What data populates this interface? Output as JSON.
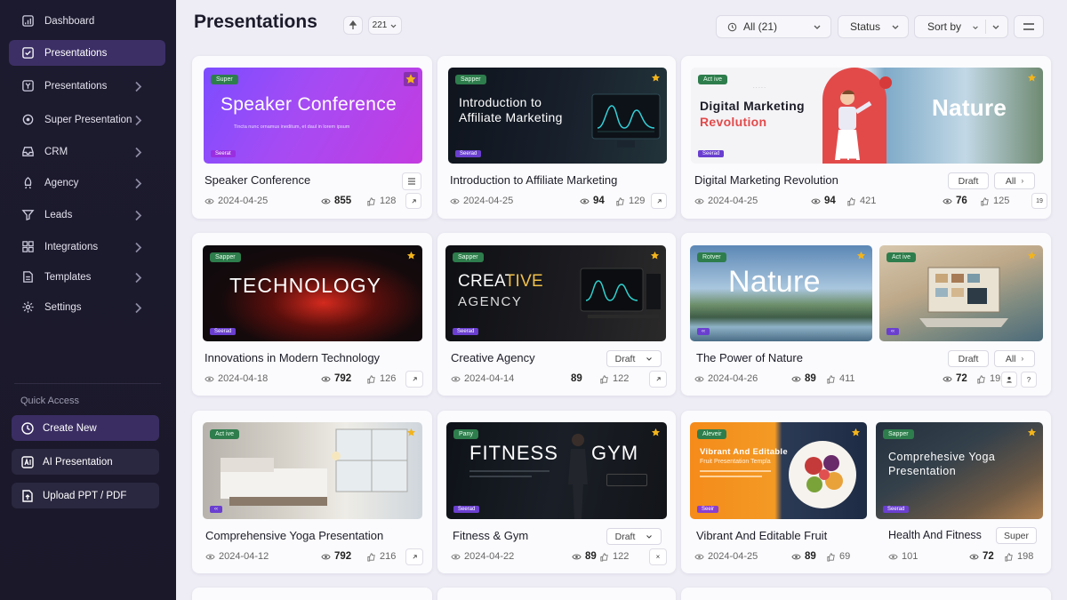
{
  "sidebar": {
    "items": [
      {
        "label": "Dashboard",
        "icon": "dashboard-icon"
      },
      {
        "label": "Presentations",
        "icon": "check-square-icon",
        "active": true
      },
      {
        "label": "Presentations",
        "icon": "y-square-icon"
      },
      {
        "label": "Super Presentation",
        "icon": "gear-badge-icon"
      },
      {
        "label": "CRM",
        "icon": "tray-icon"
      },
      {
        "label": "Agency",
        "icon": "rocket-icon"
      },
      {
        "label": "Leads",
        "icon": "funnel-icon"
      },
      {
        "label": "Integrations",
        "icon": "grid-icon"
      },
      {
        "label": "Templates",
        "icon": "document-icon"
      },
      {
        "label": "Settings",
        "icon": "settings-icon"
      }
    ],
    "quick_access": {
      "title": "Quick Access",
      "buttons": [
        {
          "label": "Create New",
          "icon": "clock-icon"
        },
        {
          "label": "AI Presentation",
          "icon": "ai-icon"
        },
        {
          "label": "Upload PPT / PDF",
          "icon": "upload-icon"
        }
      ]
    }
  },
  "header": {
    "title": "Presentations",
    "count_select": "221",
    "filter_all": "All (21)",
    "status": "Status",
    "sort": "Sort by"
  },
  "cards": [
    {
      "thumb_title": "Speaker Conference",
      "thumb_sub": "Tincta nunc ornamus ineditum, et daul in lorem ipsum",
      "badge": "Super",
      "tag": "Seerat",
      "title": "Speaker Conference",
      "date": "2024-04-25",
      "views": "855",
      "likes": "128"
    },
    {
      "thumb_title": "Introduction to Affiliate Marketing",
      "badge": "Sapper",
      "tag": "Seerad",
      "title": "Introduction to Affiliate Marketing",
      "date": "2024-04-25",
      "views": "94",
      "likes": "129"
    },
    {
      "thumb_title": "Digital Marketing",
      "thumb_title2": "Revolution",
      "thumb_title3": "Nature",
      "badge": "Act ive",
      "tag": "Seerad",
      "title": "Digital Marketing Revolution",
      "date": "2024-04-25",
      "views": "94",
      "likes": "421",
      "views2": "76",
      "likes2": "125",
      "chip1": "Draft",
      "chip2": "All",
      "count": "19"
    },
    {
      "thumb_title": "TECHNOLOGY",
      "badge": "Sapper",
      "tag": "Seerad",
      "title": "Innovations in Modern Technology",
      "date": "2024-04-18",
      "views": "792",
      "likes": "126"
    },
    {
      "thumb_title": "CREATIVE",
      "thumb_title2": "AGENCY",
      "badge": "Sapper",
      "tag": "Seerad",
      "title": "Creative Agency",
      "date": "2024-04-14",
      "views": "89",
      "likes": "122",
      "chip1": "Draft"
    },
    {
      "thumb_title": "Nature",
      "badge": "Rotver",
      "badge2": "Act ive",
      "title": "The Power of Nature",
      "date": "2024-04-26",
      "views": "89",
      "likes": "411",
      "views2": "72",
      "likes2": "192",
      "chip1": "Draft",
      "chip2": "All"
    },
    {
      "badge": "Act ive",
      "title": "Comprehensive Yoga Presentation",
      "date": "2024-04-12",
      "views": "792",
      "likes": "216"
    },
    {
      "thumb_title": "FITNESS",
      "thumb_title2": "GYM",
      "badge": "Pany",
      "tag": "Seerad",
      "title": "Fitness & Gym",
      "date": "2024-04-22",
      "views": "89",
      "likes": "122",
      "chip1": "Draft"
    },
    {
      "thumb_title": "Vibrant And Editable",
      "thumb_title2": "Fruit Presentation Templa",
      "thumb_title3": "Comprehesive Yoga",
      "thumb_title4": "Presentation",
      "badge": "Aleveir",
      "badge2": "Sapper",
      "tag": "Seeir",
      "tag2": "Seerad",
      "title": "Vibrant And Editable Fruit",
      "title2": "Health And Fitness",
      "date": "2024-04-25",
      "views": "89",
      "likes": "69",
      "views2": "101",
      "views3": "72",
      "likes2": "198",
      "chip1": "Super"
    }
  ],
  "colors": {
    "accent": "#3c2f66",
    "sidebar": "#1c1a2e",
    "star": "#f2b41c",
    "badge": "#2e7d4c"
  }
}
